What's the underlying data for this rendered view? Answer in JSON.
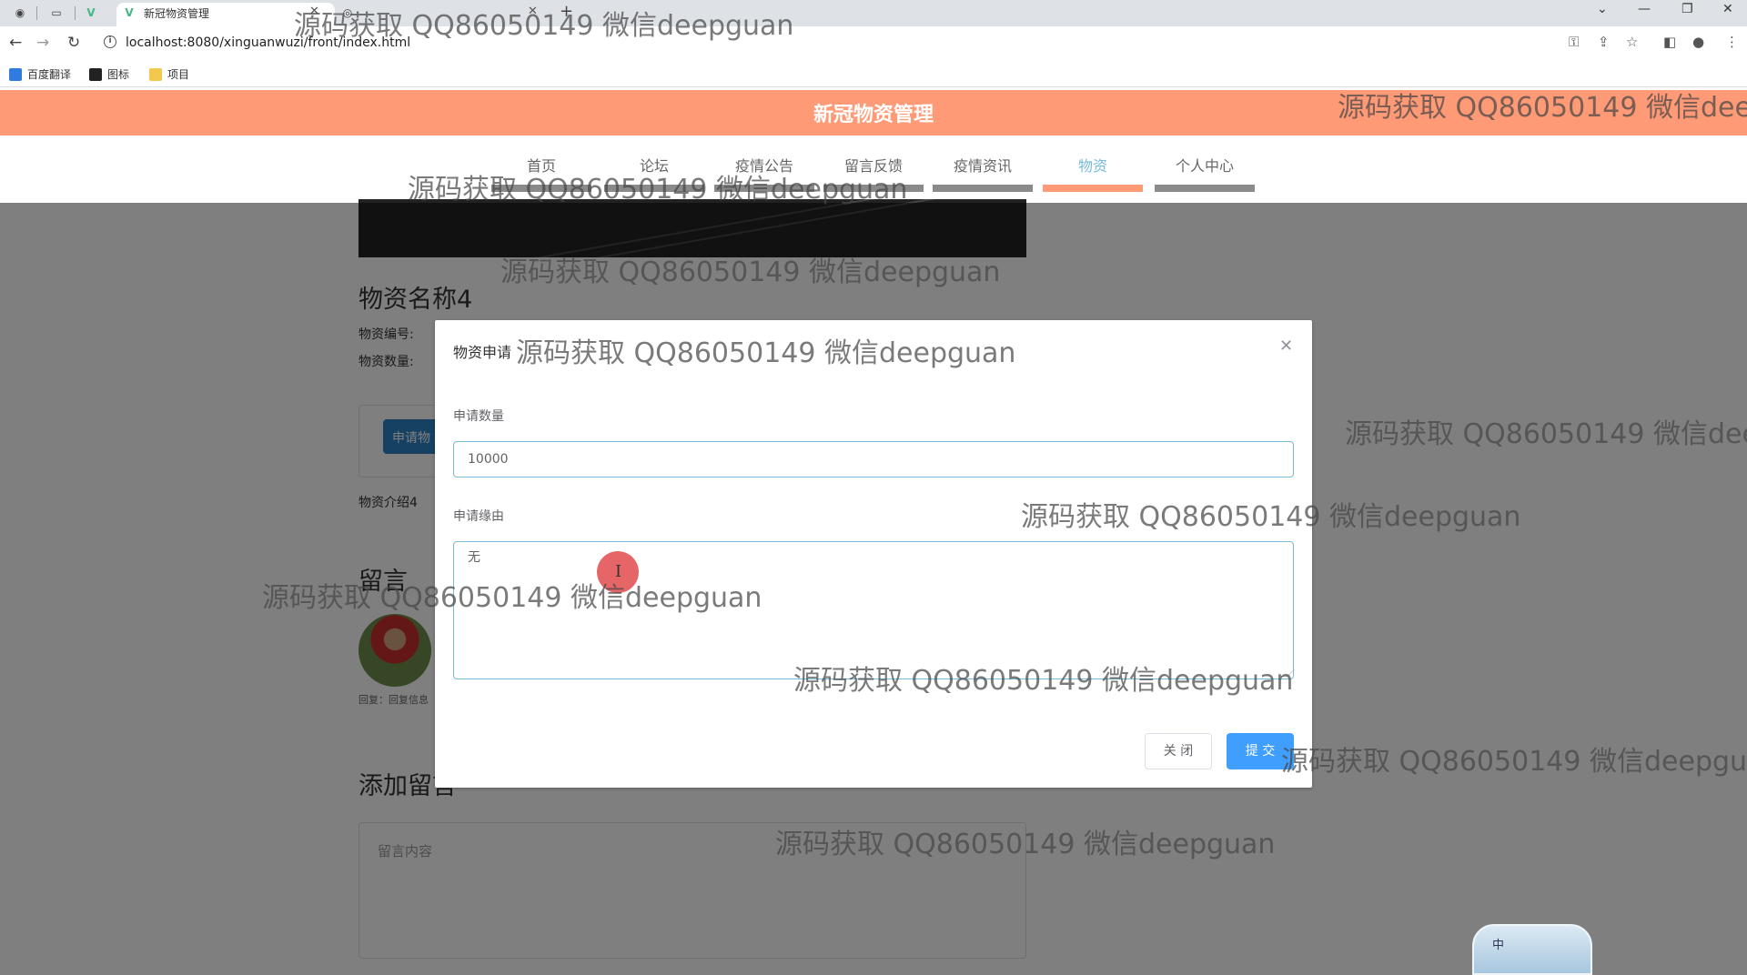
{
  "browser": {
    "active_tab_title": "新冠物资管理",
    "second_tab_title": "",
    "url": "localhost:8080/xinguanwuzi/front/index.html",
    "bookmarks": [
      "百度翻译",
      "图标",
      "项目"
    ]
  },
  "site": {
    "title": "新冠物资管理",
    "nav": [
      {
        "label": "首页",
        "active": false
      },
      {
        "label": "论坛",
        "active": false
      },
      {
        "label": "疫情公告",
        "active": false
      },
      {
        "label": "留言反馈",
        "active": false
      },
      {
        "label": "疫情资讯",
        "active": false
      },
      {
        "label": "物资",
        "active": true
      },
      {
        "label": "个人中心",
        "active": false
      }
    ],
    "accent_color": "#ff9a76",
    "active_nav_color": "#76bbd9"
  },
  "product": {
    "name": "物资名称4",
    "code_label": "物资编号:",
    "qty_label": "物资数量:",
    "apply_button": "申请物",
    "intro": "物资介绍4"
  },
  "comments": {
    "title": "留言",
    "reply": "回复：回复信息",
    "add_title": "添加留言",
    "placeholder": "留言内容"
  },
  "dialog": {
    "title": "物资申请",
    "quantity_label": "申请数量",
    "quantity_value": "10000",
    "reason_label": "申请缘由",
    "reason_value": "无",
    "close_button": "关 闭",
    "submit_button": "提 交",
    "submit_color": "#409eff"
  },
  "ime": {
    "mode": "中"
  },
  "watermark": "源码获取 QQ86050149 微信deepguan"
}
